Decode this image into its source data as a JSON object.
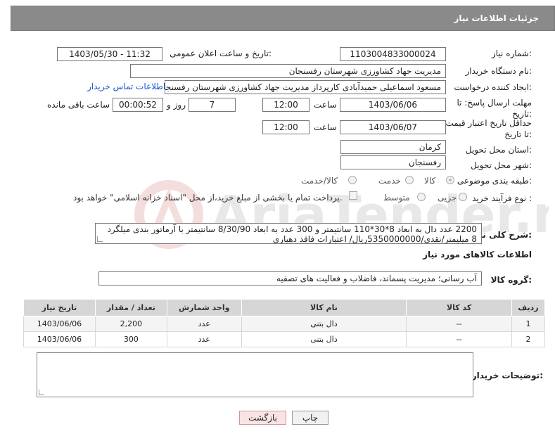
{
  "header": {
    "title": "جزئیات اطلاعات نیاز"
  },
  "fields": {
    "need_number": {
      "label": "شماره نیاز:",
      "value": "1103004833000024"
    },
    "announce_datetime": {
      "label": "تاریخ و ساعت اعلان عمومی:",
      "value": "1403/05/30 - 11:32"
    },
    "buyer_org": {
      "label": "نام دستگاه خریدار:",
      "value": "مدیریت جهاد کشاورزی شهرستان رفسنجان"
    },
    "requester": {
      "label": "ایجاد کننده درخواست:",
      "value": "مسعود اسماعیلی حمیدآبادی کارپرداز مدیریت جهاد کشاورزی شهرستان رفسنجان",
      "contact_link": "اطلاعات تماس خریدار"
    },
    "deadline": {
      "label": "مهلت ارسال پاسخ: تا تاریخ:",
      "date": "1403/06/06",
      "time_label": "ساعت",
      "time": "12:00",
      "days": "7",
      "days_label": "روز و",
      "remaining": "00:00:52",
      "remaining_label": "ساعت باقی مانده"
    },
    "price_validity": {
      "label": "حداقل تاریخ اعتبار قیمت: تا تاریخ:",
      "date": "1403/06/07",
      "time_label": "ساعت",
      "time": "12:00"
    },
    "province": {
      "label": "استان محل تحویل:",
      "value": "کرمان"
    },
    "city": {
      "label": "شهر محل تحویل:",
      "value": "رفسنجان"
    },
    "category": {
      "label": "طبقه بندی موضوعی:",
      "options": [
        "کالا",
        "خدمت",
        "کالا/خدمت"
      ]
    },
    "process": {
      "label": "نوع فرآیند خرید :",
      "options": [
        "جزیی",
        "متوسط"
      ],
      "payment_note": "پرداخت تمام یا بخشی از مبلغ خرید،از محل \"اسناد خزانه اسلامی\" خواهد بود."
    }
  },
  "description": {
    "label": "شرح کلی نیاز:",
    "text": "2200 عدد دال به ابعاد 8*30*110 سانتیمتر و 300 عدد به ابعاد 8/30/90 سانتیمتر با آرماتور بندی میلگرد 8 میلیمتر/نقدی/5350000000ریال/ اعتبارات فاقد دهیاری"
  },
  "goods": {
    "section_title": "اطلاعات کالاهای مورد نیاز",
    "group_label": "گروه کالا:",
    "group_value": "آب رسانی؛ مدیریت پسماند، فاضلاب و فعالیت های تصفیه",
    "columns": [
      "ردیف",
      "کد کالا",
      "نام کالا",
      "واحد شمارش",
      "تعداد / مقدار",
      "تاریخ نیاز"
    ],
    "rows": [
      {
        "row": "1",
        "code": "--",
        "name": "دال بتنی",
        "unit": "عدد",
        "qty": "2,200",
        "date": "1403/06/06"
      },
      {
        "row": "2",
        "code": "--",
        "name": "دال بتنی",
        "unit": "عدد",
        "qty": "300",
        "date": "1403/06/06"
      }
    ]
  },
  "notes": {
    "label": "توضیحات خریدار:"
  },
  "buttons": {
    "print": "چاپ",
    "back": "بازگشت"
  },
  "watermark": {
    "text": "AriaTender.net"
  }
}
